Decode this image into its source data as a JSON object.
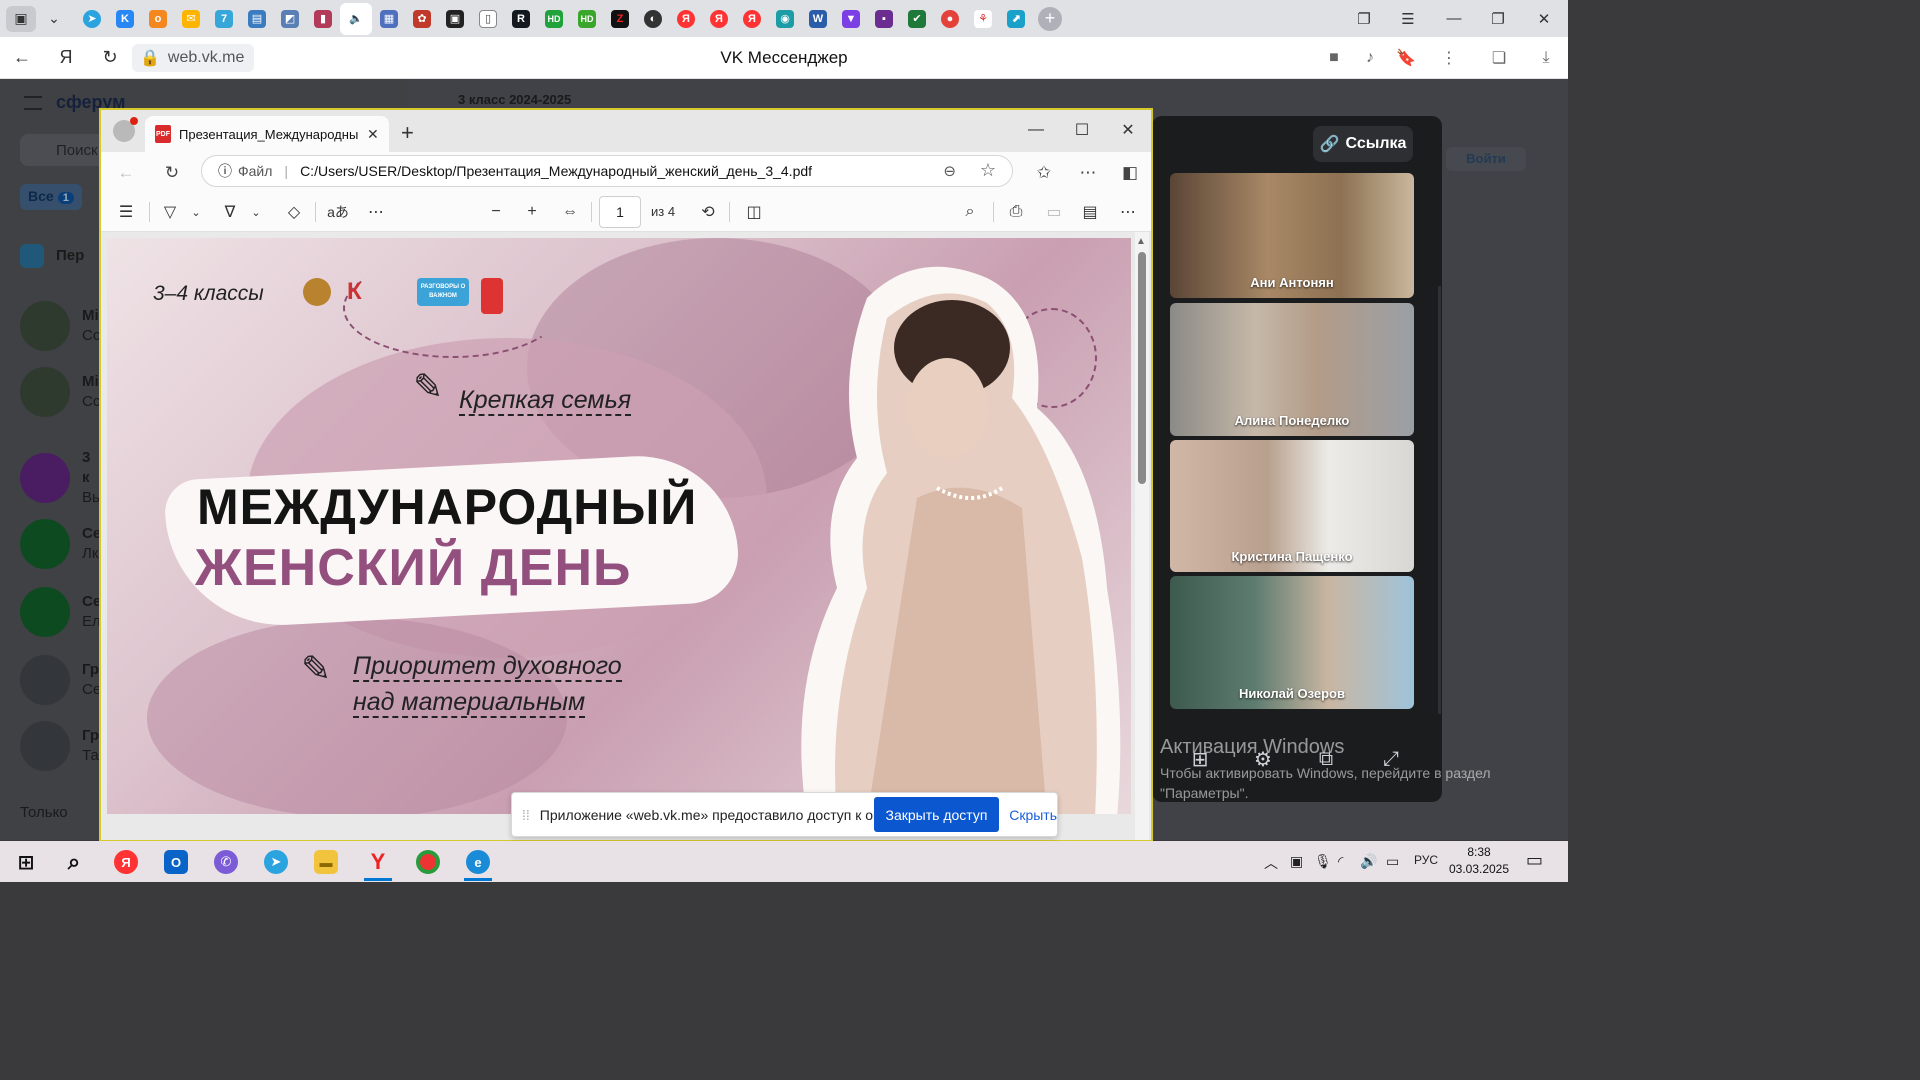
{
  "browser": {
    "url_short": "web.vk.me",
    "page_title": "VK Мессенджер"
  },
  "vk": {
    "logo_text": "сферум",
    "search_placeholder": "Поиск",
    "filter_label": "Все",
    "filter_count": "1",
    "chat_header": "3 класс 2024-2025",
    "join_label": "Войти",
    "bottom_label": "Только",
    "rows": [
      {
        "title": "Пер"
      },
      {
        "title": "Мі",
        "sub": "Сс"
      },
      {
        "title": "Мі",
        "sub": "Сс"
      },
      {
        "title": "3 к",
        "sub": "Вь"
      },
      {
        "title": "Се",
        "sub": "Лк"
      },
      {
        "title": "Се",
        "sub": "Ел"
      },
      {
        "title": "Гр",
        "sub": "Се"
      },
      {
        "title": "Гр",
        "sub": "Та"
      }
    ]
  },
  "call": {
    "link_label": "Ссылка",
    "participants": [
      {
        "name": "Ани Антонян"
      },
      {
        "name": "Алина Понеделко"
      },
      {
        "name": "Кристина Пащенко"
      },
      {
        "name": "Николай Озеров"
      }
    ]
  },
  "windows_activation": {
    "title": "Активация Windows",
    "text": "Чтобы активировать Windows, перейдите в раздел \"Параметры\"."
  },
  "pdf": {
    "tab_title": "Презентация_Международный_",
    "file_label": "Файл",
    "path": "C:/Users/USER/Desktop/Презентация_Международный_женский_день_3_4.pdf",
    "page_current": "1",
    "page_total_label": "из 4",
    "slide": {
      "grade": "3–4 классы",
      "logo_text": "РАЗГОВОРЫ О ВАЖНОМ",
      "thesis1": "Крепкая семья",
      "title_line1": "МЕЖДУНАРОДНЫЙ",
      "title_line2": "ЖЕНСКИЙ ДЕНЬ",
      "thesis2_line1": "Приоритет духовного",
      "thesis2_line2": "над материальным"
    }
  },
  "share_bar": {
    "message": "Приложение «web.vk.me» предоставило доступ к окну.",
    "stop_label": "Закрыть доступ",
    "hide_label": "Скрыть"
  },
  "taskbar": {
    "lang": "РУС",
    "time": "8:38",
    "date": "03.03.2025"
  }
}
